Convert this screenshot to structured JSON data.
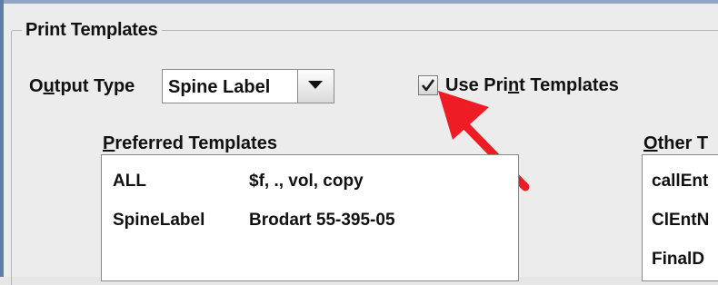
{
  "print_templates": {
    "group_title": "Print Templates",
    "output_type": {
      "label_prefix": "O",
      "label_mnemonic": "u",
      "label_suffix": "tput Type",
      "selected_value": "Spine Label"
    },
    "use_print_templates": {
      "checked": true,
      "label_prefix": "Use Pri",
      "label_mnemonic": "n",
      "label_suffix": "t Templates"
    },
    "preferred_templates": {
      "label_mnemonic": "P",
      "label_rest": "referred Templates",
      "rows": [
        {
          "name": "ALL",
          "value": "$f, ., vol, copy"
        },
        {
          "name": "SpineLabel",
          "value": "Brodart 55-395-05"
        }
      ]
    },
    "other_templates": {
      "label_mnemonic": "O",
      "label_rest": "ther T",
      "rows": [
        "callEnt",
        "ClEntN",
        "FinalD"
      ]
    }
  },
  "annotation": {
    "arrow_color": "#ee1c24"
  }
}
